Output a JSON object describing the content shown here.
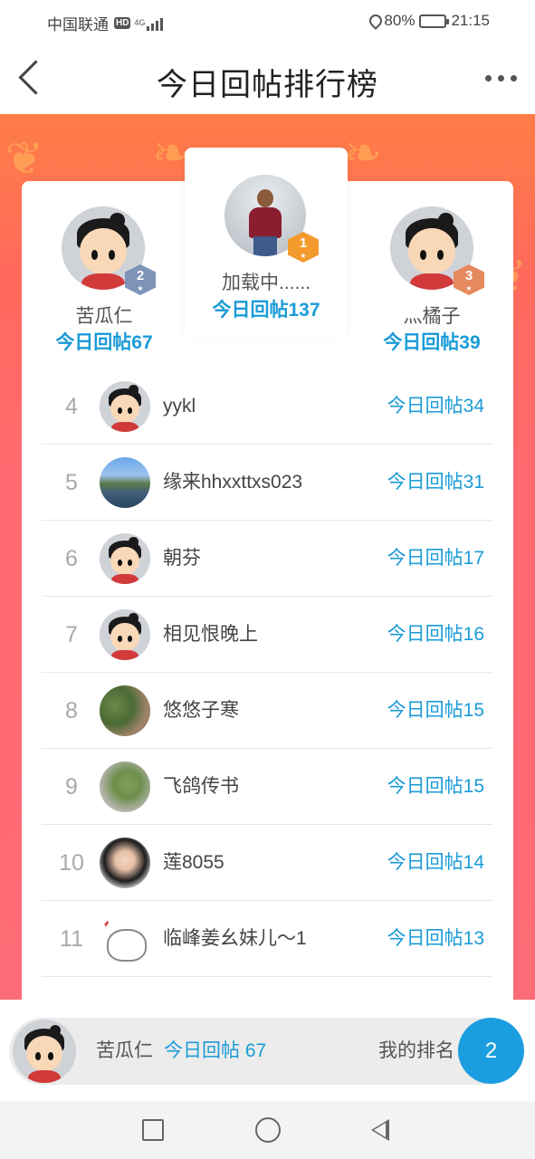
{
  "status_bar": {
    "carrier": "中国联通",
    "hd": "HD",
    "network": "4G",
    "battery": "80%",
    "battery_level": 0.8,
    "time": "21:15"
  },
  "header": {
    "title": "今日回帖排行榜"
  },
  "colors": {
    "accent": "#1a9bd7",
    "banner": "#fd6b76",
    "gold": "#f39a2c",
    "silver": "#7d93b8",
    "bronze": "#e58a5e"
  },
  "podium": [
    {
      "rank": "2",
      "name": "苦瓜仁",
      "count_label": "今日回帖67",
      "avatar": "cartoon-girl"
    },
    {
      "rank": "1",
      "name": "加载中......",
      "count_label": "今日回帖137",
      "avatar": "photo-man-snow"
    },
    {
      "rank": "3",
      "name": "灬橘子",
      "count_label": "今日回帖39",
      "avatar": "cartoon-girl"
    }
  ],
  "list": [
    {
      "rank": "4",
      "name": "yykl",
      "count_label": "今日回帖34",
      "avatar": "cartoon-girl"
    },
    {
      "rank": "5",
      "name": "缘来hhxxttxs023",
      "count_label": "今日回帖31",
      "avatar": "photo-lake"
    },
    {
      "rank": "6",
      "name": "朝芬",
      "count_label": "今日回帖17",
      "avatar": "cartoon-girl"
    },
    {
      "rank": "7",
      "name": "相见恨晚上",
      "count_label": "今日回帖16",
      "avatar": "cartoon-girl"
    },
    {
      "rank": "8",
      "name": "悠悠子寒",
      "count_label": "今日回帖15",
      "avatar": "photo-garden"
    },
    {
      "rank": "9",
      "name": "飞鸽传书",
      "count_label": "今日回帖15",
      "avatar": "photo-hand"
    },
    {
      "rank": "10",
      "name": "莲8055",
      "count_label": "今日回帖14",
      "avatar": "photo-woman"
    },
    {
      "rank": "11",
      "name": "临峰姜幺妹儿～1",
      "count_label": "今日回帖13",
      "avatar": "cartoon-cat"
    }
  ],
  "my_rank": {
    "name": "苦瓜仁",
    "count_label": "今日回帖 67",
    "rank_label": "我的排名",
    "rank": "2"
  }
}
